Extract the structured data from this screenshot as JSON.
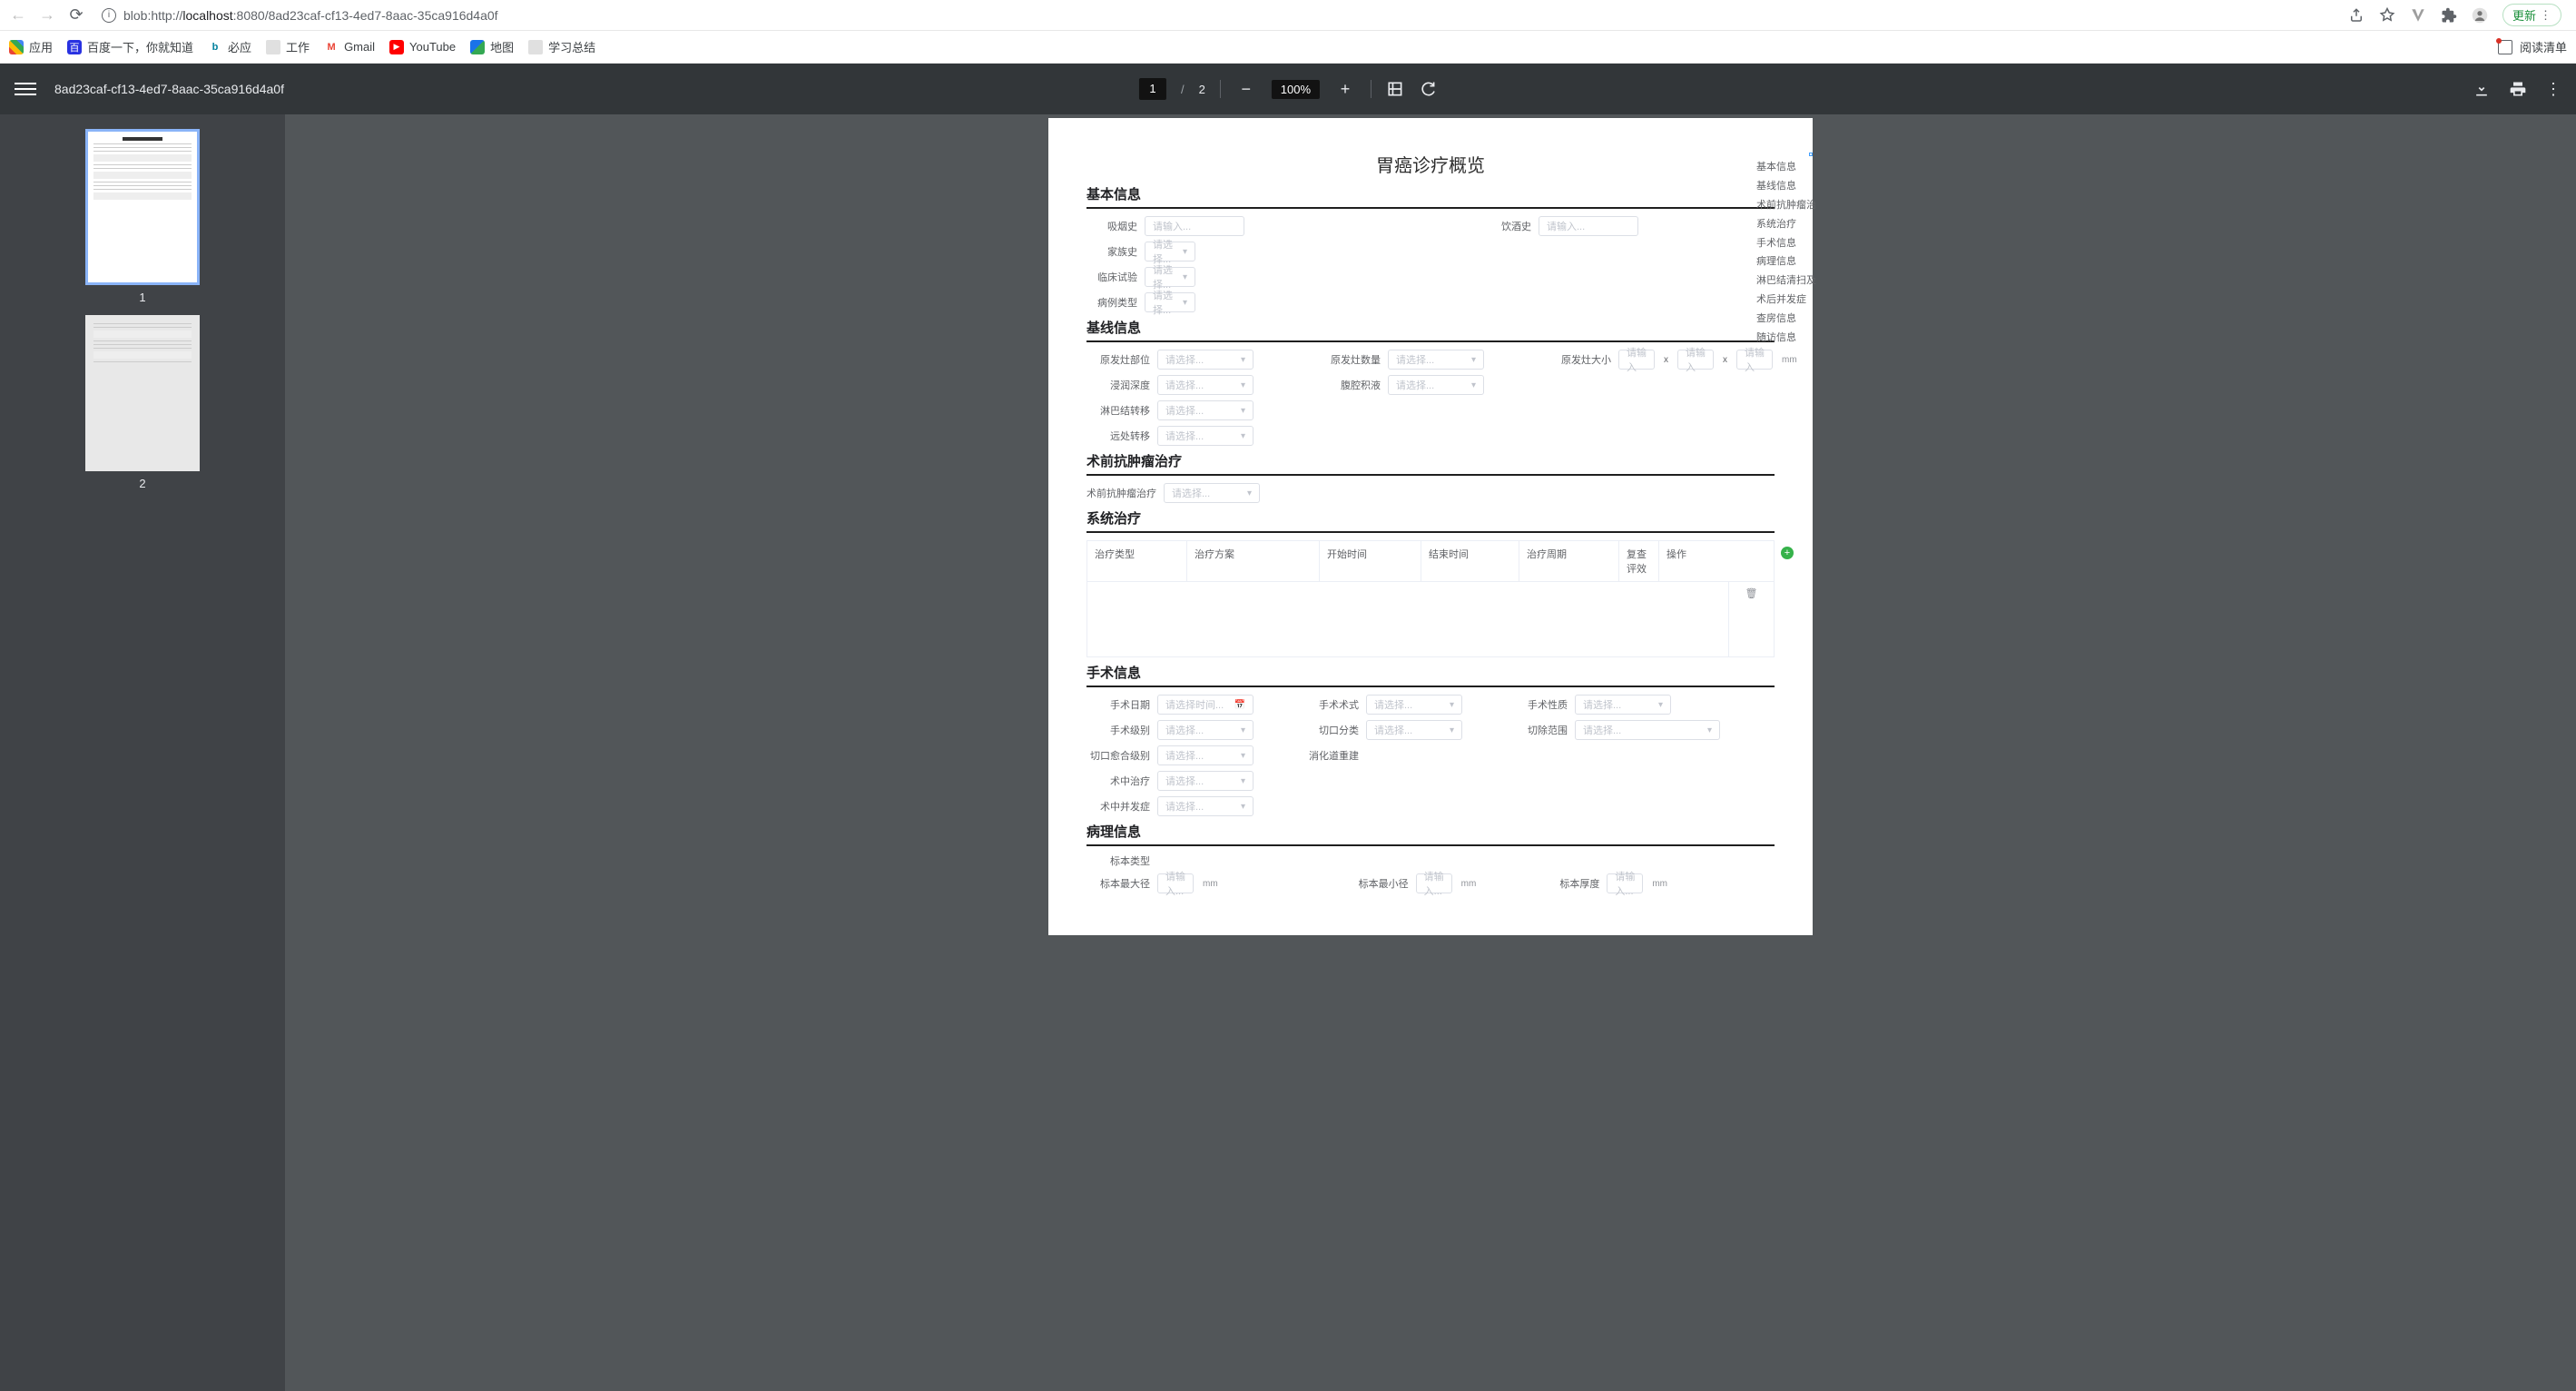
{
  "browser": {
    "url_prefix": "blob:http://",
    "url_host": "localhost",
    "url_rest": ":8080/8ad23caf-cf13-4ed7-8aac-35ca916d4a0f",
    "update_label": "更新",
    "reading_list": "阅读清单"
  },
  "bookmarks": [
    {
      "label": "应用",
      "icon": "apps"
    },
    {
      "label": "百度一下，你就知道",
      "icon": "baidu"
    },
    {
      "label": "必应",
      "icon": "bing"
    },
    {
      "label": "工作",
      "icon": "folder"
    },
    {
      "label": "Gmail",
      "icon": "gmail"
    },
    {
      "label": "YouTube",
      "icon": "yt"
    },
    {
      "label": "地图",
      "icon": "maps"
    },
    {
      "label": "学习总结",
      "icon": "folder"
    }
  ],
  "pdf": {
    "title": "8ad23caf-cf13-4ed7-8aac-35ca916d4a0f",
    "current_page": "1",
    "total_pages": "2",
    "zoom": "100%",
    "thumb1_label": "1",
    "thumb2_label": "2"
  },
  "doc": {
    "title": "胃癌诊疗概览",
    "placeholder_input": "请输入...",
    "placeholder_select": "请选择...",
    "placeholder_date": "请选择时间...",
    "sections": {
      "basic": "基本信息",
      "baseline": "基线信息",
      "preop": "术前抗肿瘤治疗",
      "systemic": "系统治疗",
      "surgery": "手术信息",
      "pathology": "病理信息"
    },
    "basic": {
      "smoking": "吸烟史",
      "drinking": "饮酒史",
      "family": "家族史",
      "clinical_trial": "临床试验",
      "case_type": "病例类型"
    },
    "baseline": {
      "primary_site": "原发灶部位",
      "primary_count": "原发灶数量",
      "primary_size": "原发灶大小",
      "invasion_depth": "浸润深度",
      "ascites": "腹腔积液",
      "lymph_meta": "淋巴结转移",
      "distant_meta": "远处转移",
      "unit_mm": "mm",
      "x": "x"
    },
    "preop": {
      "label": "术前抗肿瘤治疗"
    },
    "systemic_table": {
      "cols": [
        "治疗类型",
        "治疗方案",
        "开始时间",
        "结束时间",
        "治疗周期",
        "复查评效",
        "操作"
      ]
    },
    "surgery": {
      "date": "手术日期",
      "proc": "手术术式",
      "nature": "手术性质",
      "grade": "手术级别",
      "incision_class": "切口分类",
      "resection_range": "切除范围",
      "incision_heal": "切口愈合级别",
      "gi_recon": "消化道重建",
      "intraop_tx": "术中治疗",
      "complication": "术中并发症"
    },
    "pathology": {
      "specimen_type": "标本类型",
      "max_diam": "标本最大径",
      "min_diam": "标本最小径",
      "thickness": "标本厚度",
      "unit_mm": "mm"
    },
    "toc": [
      "基本信息",
      "基线信息",
      "术前抗肿瘤治",
      "系统治疗",
      "手术信息",
      "病理信息",
      "淋巴结清扫及",
      "术后并发症",
      "查房信息",
      "随访信息"
    ]
  }
}
